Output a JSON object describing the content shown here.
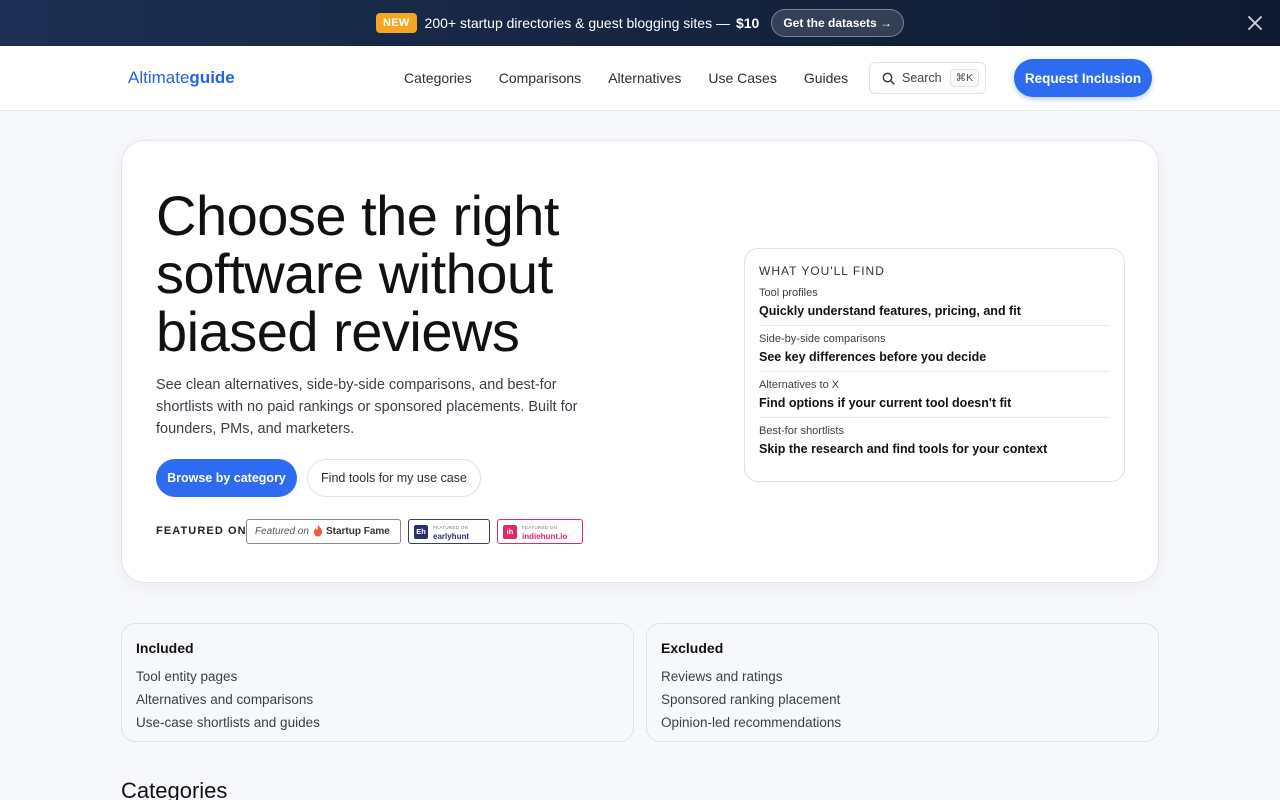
{
  "promo": {
    "badge": "NEW",
    "text": "200+ startup directories & guest blogging sites —",
    "price": "$10",
    "cta": "Get the datasets →"
  },
  "header": {
    "logo_regular": "Altimate",
    "logo_bold": "guide",
    "nav": [
      "Categories",
      "Comparisons",
      "Alternatives",
      "Use Cases",
      "Guides"
    ],
    "search_label": "Search",
    "search_shortcut": "⌘K",
    "cta": "Request Inclusion"
  },
  "hero": {
    "title": "Choose the right software without biased reviews",
    "lede": "See clean alternatives, side-by-side comparisons, and best-for shortlists with no paid rankings or sponsored placements. Built for founders, PMs, and marketers.",
    "primary_cta": "Browse by category",
    "secondary_cta": "Find tools for my use case",
    "featured_label": "FEATURED ON",
    "badges": {
      "startupfame": {
        "prefix": "Featured on",
        "name": "Startup Fame"
      },
      "earlyhunt": {
        "mark": "Eh",
        "small": "FEATURED ON",
        "name": "earlyhunt"
      },
      "indiehunt": {
        "mark": "ih",
        "small": "FEATURED ON",
        "name": "indiehunt.io"
      }
    }
  },
  "find_panel": {
    "title": "WHAT YOU'LL FIND",
    "items": [
      {
        "label": "Tool profiles",
        "desc": "Quickly understand features, pricing, and fit"
      },
      {
        "label": "Side-by-side comparisons",
        "desc": "See key differences before you decide"
      },
      {
        "label": "Alternatives to X",
        "desc": "Find options if your current tool doesn't fit"
      },
      {
        "label": "Best-for shortlists",
        "desc": "Skip the research and find tools for your context"
      }
    ]
  },
  "included": {
    "title": "Included",
    "items": [
      "Tool entity pages",
      "Alternatives and comparisons",
      "Use-case shortlists and guides"
    ]
  },
  "excluded": {
    "title": "Excluded",
    "items": [
      "Reviews and ratings",
      "Sponsored ranking placement",
      "Opinion-led recommendations"
    ]
  },
  "categories_heading": "Categories",
  "colors": {
    "accent": "#2d6bf0",
    "promo_bg": "#1c2f52",
    "new_badge": "#f5a524"
  }
}
